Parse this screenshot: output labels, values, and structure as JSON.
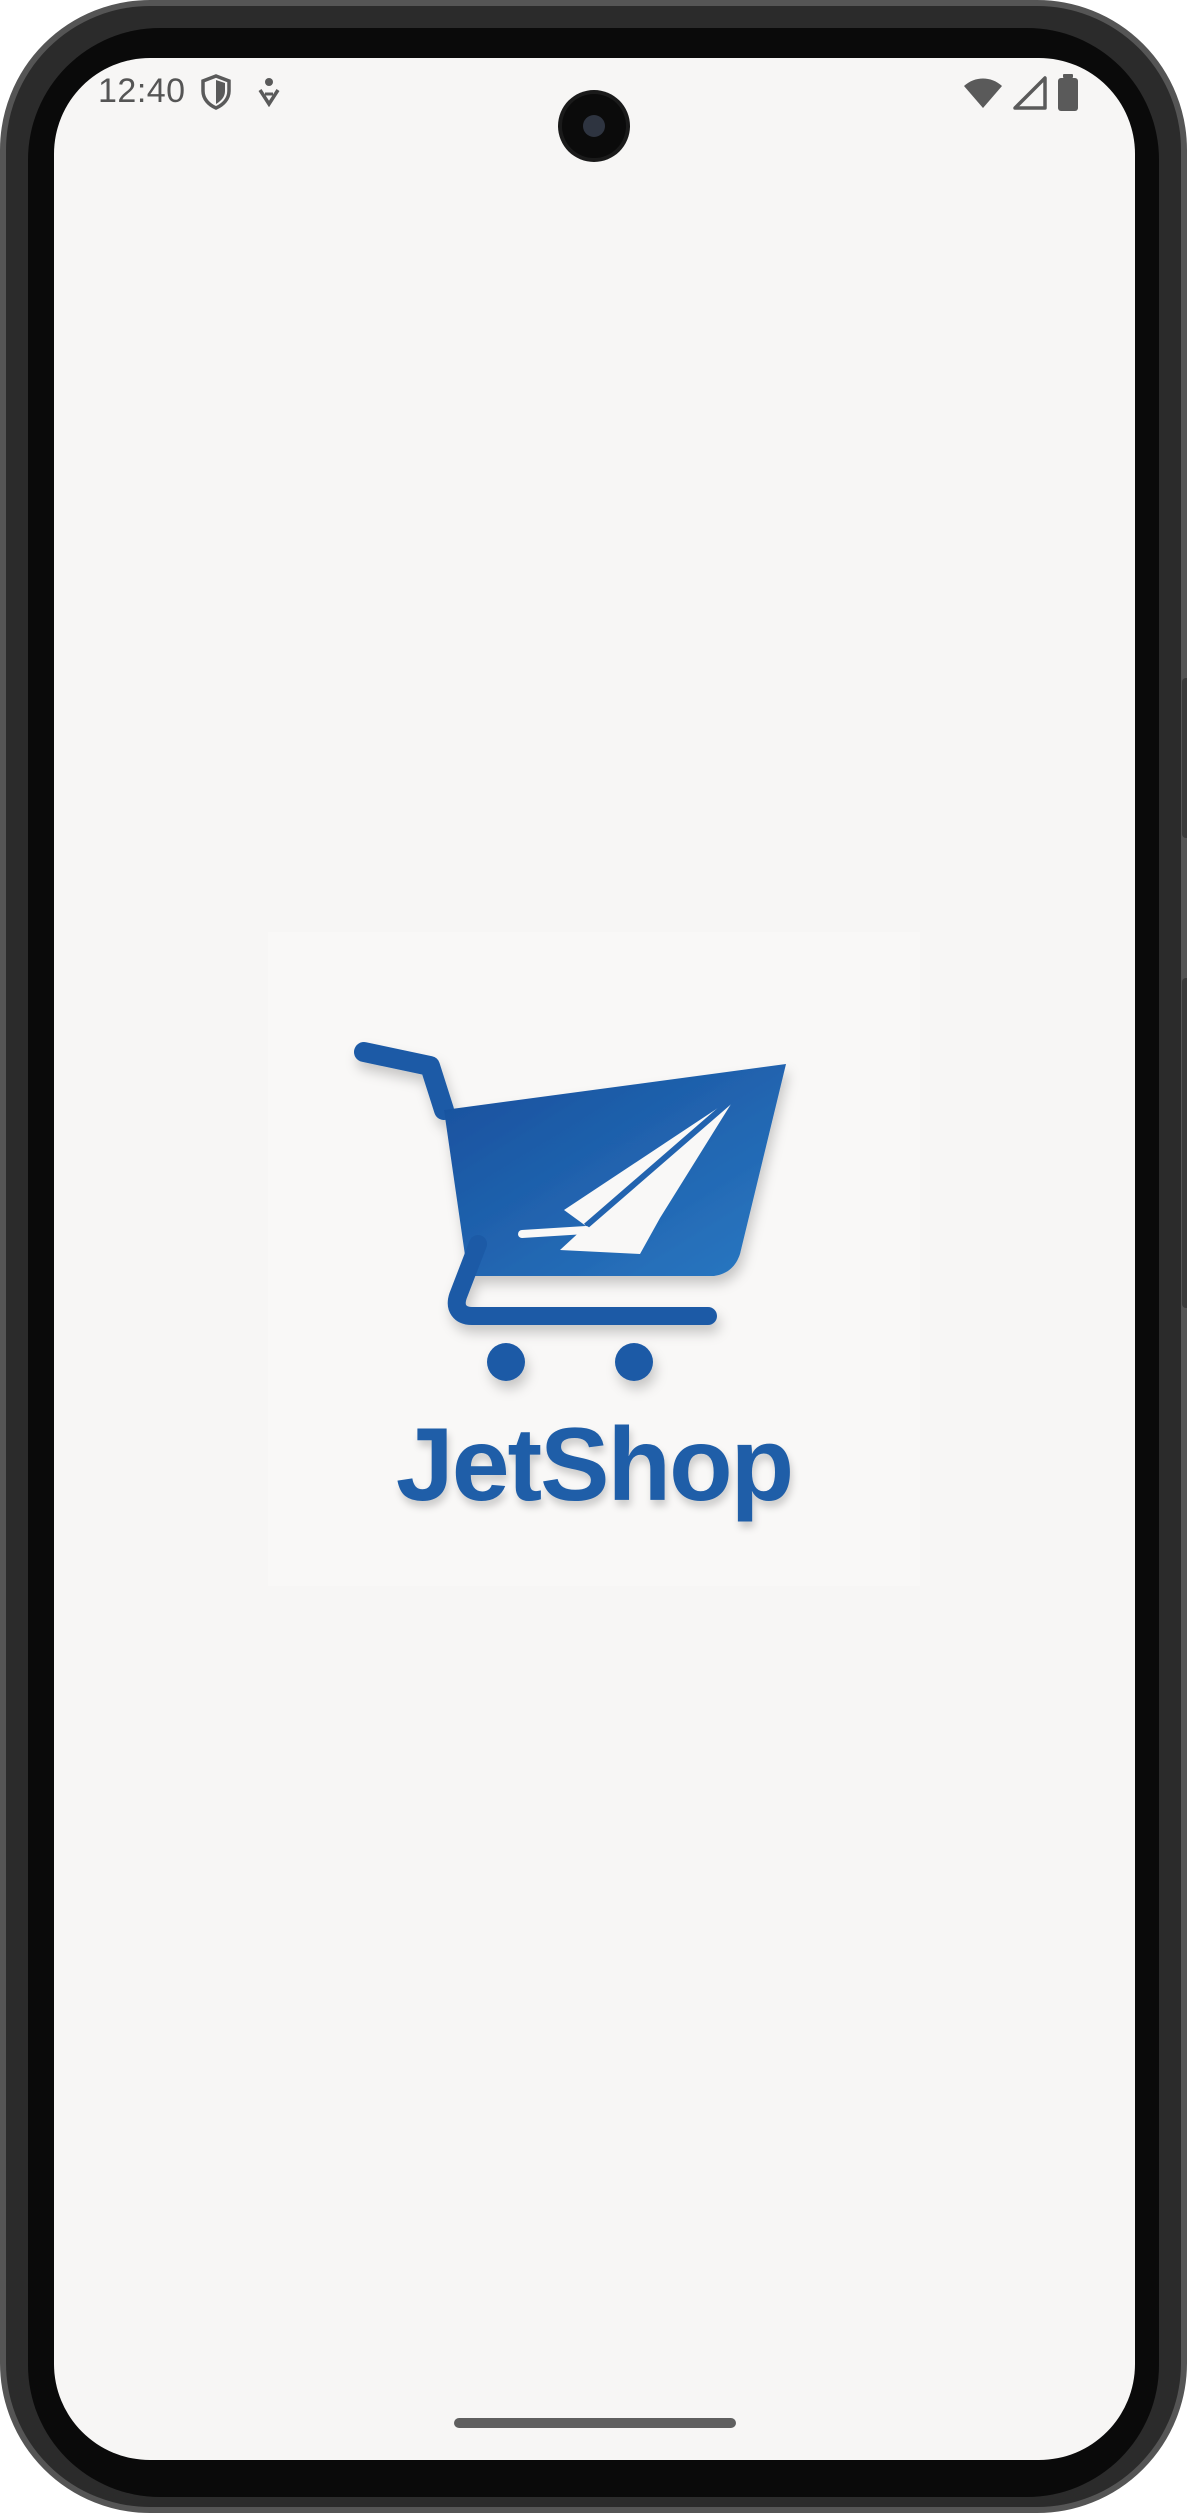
{
  "status_bar": {
    "time": "12:40",
    "left_icons": [
      "shield-icon",
      "accessibility-icon"
    ],
    "right_icons": [
      "wifi-icon",
      "signal-icon",
      "battery-icon"
    ]
  },
  "splash": {
    "app_name": "JetShop",
    "logo_icon": "shopping-cart-jet-icon",
    "colors": {
      "brand_blue": "#1f5ea8",
      "background": "#f7f6f5"
    }
  }
}
